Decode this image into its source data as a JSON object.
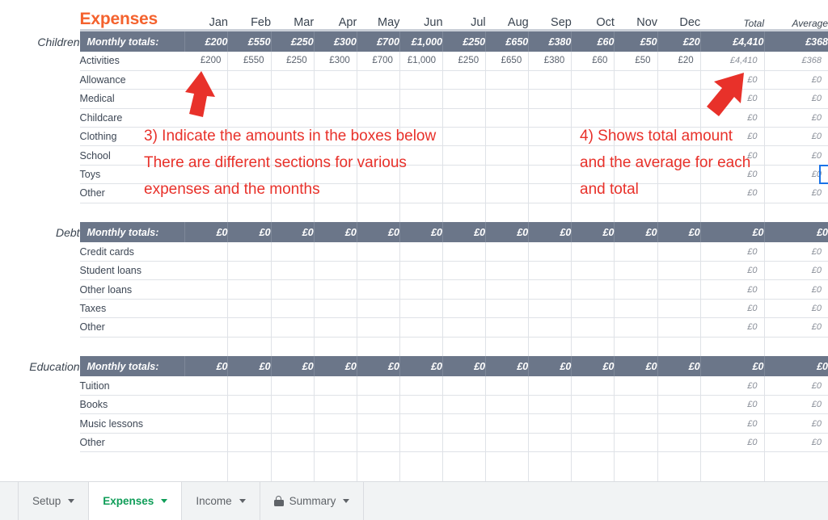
{
  "sheet": {
    "title": "Expenses",
    "title_color": "#f4622e",
    "header_band_color": "#6b7689",
    "annotation_color": "#e8312a",
    "month_columns": [
      "Jan",
      "Feb",
      "Mar",
      "Apr",
      "May",
      "Jun",
      "Jul",
      "Aug",
      "Sep",
      "Oct",
      "Nov",
      "Dec"
    ],
    "total_column": "Total",
    "average_column": "Average",
    "totals_row_label": "Monthly totals:"
  },
  "sections": [
    {
      "name": "Children",
      "totals": {
        "label": "Monthly totals:",
        "months": [
          "£200",
          "£550",
          "£250",
          "£300",
          "£700",
          "£1,000",
          "£250",
          "£650",
          "£380",
          "£60",
          "£50",
          "£20"
        ],
        "total": "£4,410",
        "average": "£368"
      },
      "rows": [
        {
          "label": "Activities",
          "months": [
            "£200",
            "£550",
            "£250",
            "£300",
            "£700",
            "£1,000",
            "£250",
            "£650",
            "£380",
            "£60",
            "£50",
            "£20"
          ],
          "total": "£4,410",
          "average": "£368"
        },
        {
          "label": "Allowance",
          "months": [
            "",
            "",
            "",
            "",
            "",
            "",
            "",
            "",
            "",
            "",
            "",
            ""
          ],
          "total": "£0",
          "average": "£0"
        },
        {
          "label": "Medical",
          "months": [
            "",
            "",
            "",
            "",
            "",
            "",
            "",
            "",
            "",
            "",
            "",
            ""
          ],
          "total": "£0",
          "average": "£0"
        },
        {
          "label": "Childcare",
          "months": [
            "",
            "",
            "",
            "",
            "",
            "",
            "",
            "",
            "",
            "",
            "",
            ""
          ],
          "total": "£0",
          "average": "£0"
        },
        {
          "label": "Clothing",
          "months": [
            "",
            "",
            "",
            "",
            "",
            "",
            "",
            "",
            "",
            "",
            "",
            ""
          ],
          "total": "£0",
          "average": "£0"
        },
        {
          "label": "School",
          "months": [
            "",
            "",
            "",
            "",
            "",
            "",
            "",
            "",
            "",
            "",
            "",
            ""
          ],
          "total": "£0",
          "average": "£0"
        },
        {
          "label": "Toys",
          "months": [
            "",
            "",
            "",
            "",
            "",
            "",
            "",
            "",
            "",
            "",
            "",
            ""
          ],
          "total": "£0",
          "average": "£0"
        },
        {
          "label": "Other",
          "months": [
            "",
            "",
            "",
            "",
            "",
            "",
            "",
            "",
            "",
            "",
            "",
            ""
          ],
          "total": "£0",
          "average": "£0"
        }
      ]
    },
    {
      "name": "Debt",
      "totals": {
        "label": "Monthly totals:",
        "months": [
          "£0",
          "£0",
          "£0",
          "£0",
          "£0",
          "£0",
          "£0",
          "£0",
          "£0",
          "£0",
          "£0",
          "£0"
        ],
        "total": "£0",
        "average": "£0"
      },
      "rows": [
        {
          "label": "Credit cards",
          "months": [
            "",
            "",
            "",
            "",
            "",
            "",
            "",
            "",
            "",
            "",
            "",
            ""
          ],
          "total": "£0",
          "average": "£0"
        },
        {
          "label": "Student loans",
          "months": [
            "",
            "",
            "",
            "",
            "",
            "",
            "",
            "",
            "",
            "",
            "",
            ""
          ],
          "total": "£0",
          "average": "£0"
        },
        {
          "label": "Other loans",
          "months": [
            "",
            "",
            "",
            "",
            "",
            "",
            "",
            "",
            "",
            "",
            "",
            ""
          ],
          "total": "£0",
          "average": "£0"
        },
        {
          "label": "Taxes",
          "months": [
            "",
            "",
            "",
            "",
            "",
            "",
            "",
            "",
            "",
            "",
            "",
            ""
          ],
          "total": "£0",
          "average": "£0"
        },
        {
          "label": "Other",
          "months": [
            "",
            "",
            "",
            "",
            "",
            "",
            "",
            "",
            "",
            "",
            "",
            ""
          ],
          "total": "£0",
          "average": "£0"
        }
      ]
    },
    {
      "name": "Education",
      "totals": {
        "label": "Monthly totals:",
        "months": [
          "£0",
          "£0",
          "£0",
          "£0",
          "£0",
          "£0",
          "£0",
          "£0",
          "£0",
          "£0",
          "£0",
          "£0"
        ],
        "total": "£0",
        "average": "£0"
      },
      "rows": [
        {
          "label": "Tuition",
          "months": [
            "",
            "",
            "",
            "",
            "",
            "",
            "",
            "",
            "",
            "",
            "",
            ""
          ],
          "total": "£0",
          "average": "£0"
        },
        {
          "label": "Books",
          "months": [
            "",
            "",
            "",
            "",
            "",
            "",
            "",
            "",
            "",
            "",
            "",
            ""
          ],
          "total": "£0",
          "average": "£0"
        },
        {
          "label": "Music lessons",
          "months": [
            "",
            "",
            "",
            "",
            "",
            "",
            "",
            "",
            "",
            "",
            "",
            ""
          ],
          "total": "£0",
          "average": "£0"
        },
        {
          "label": "Other",
          "months": [
            "",
            "",
            "",
            "",
            "",
            "",
            "",
            "",
            "",
            "",
            "",
            ""
          ],
          "total": "£0",
          "average": "£0"
        }
      ]
    }
  ],
  "annotations": [
    {
      "id": "left",
      "lines": [
        "3) Indicate the amounts in the boxes below",
        "There are different sections for various",
        "expenses and the months"
      ]
    },
    {
      "id": "right",
      "lines": [
        "4) Shows total amount",
        "and the average for each",
        "and total"
      ]
    }
  ],
  "sheet_tabs": [
    {
      "label": "Setup",
      "active": false,
      "locked": false
    },
    {
      "label": "Expenses",
      "active": true,
      "locked": false
    },
    {
      "label": "Income",
      "active": false,
      "locked": false
    },
    {
      "label": "Summary",
      "active": false,
      "locked": true
    }
  ]
}
